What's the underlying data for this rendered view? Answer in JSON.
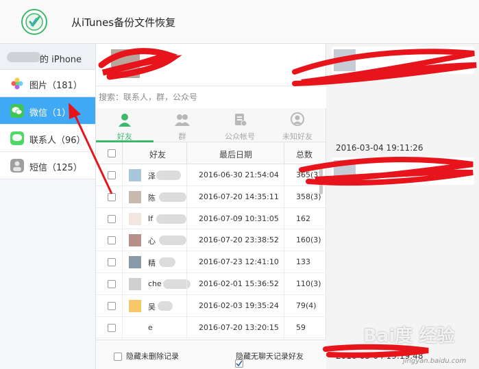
{
  "header": {
    "title": "从iTunes备份文件恢复"
  },
  "sidebar": {
    "device": "的 iPhone",
    "items": [
      {
        "label": "图片（181）",
        "icon": "photos-icon",
        "active": false
      },
      {
        "label": "微信（1）",
        "icon": "wechat-icon",
        "active": true
      },
      {
        "label": "联系人（96）",
        "icon": "contacts-icon",
        "active": false
      },
      {
        "label": "短信（125）",
        "icon": "sms-icon",
        "active": false
      }
    ]
  },
  "search": {
    "placeholder": "搜索：联系人，群，公众号"
  },
  "tabs": [
    "好友",
    "群",
    "公众帐号",
    "未知好友"
  ],
  "table": {
    "headers": [
      "好友",
      "最后日期",
      "总数"
    ],
    "rows": [
      {
        "name": "泽",
        "date": "2016-06-30 21:54:04",
        "total": "365(3)"
      },
      {
        "name": "陈",
        "date": "2016-07-20 14:35:11",
        "total": "358(3)"
      },
      {
        "name": "If",
        "date": "2016-07-09 10:31:05",
        "total": "162"
      },
      {
        "name": "心",
        "date": "2016-07-20 23:38:52",
        "total": "160(3)"
      },
      {
        "name": "精",
        "date": "2016-07-23 12:41:10",
        "total": "133"
      },
      {
        "name": "che",
        "date": "2016-02-01 15:36:52",
        "total": "110(3)"
      },
      {
        "name": "吴",
        "date": "2016-02-03 19:35:24",
        "total": "79(4)"
      },
      {
        "name": "e",
        "date": "2016-07-20 13:20:15",
        "total": "59"
      }
    ]
  },
  "footer": {
    "opt1": "隐藏未删除记录",
    "opt2": "隐藏无聊天记录好友"
  },
  "chat": {
    "ts1": "2016-03-04 19:11:26",
    "ts2": "2016-03-04 19:19:48"
  },
  "watermark": {
    "text": "Bai度 经验",
    "url": "jingyan.baidu.com"
  },
  "colors": {
    "accent": "#3fa9f5",
    "wechat_green": "#3db86b",
    "annotation": "#e8141b"
  }
}
